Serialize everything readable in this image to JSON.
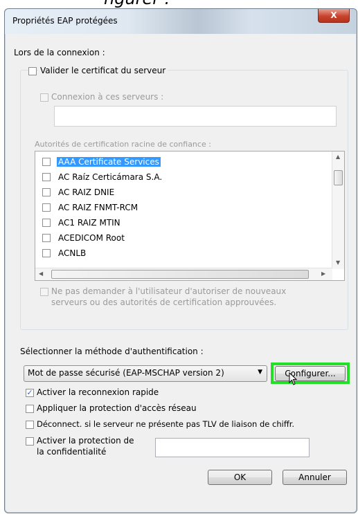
{
  "top_fragment": "ngurer :",
  "window": {
    "title": "Propriétés EAP protégées",
    "close_label": "X"
  },
  "section_connect": "Lors de la connexion :",
  "validate_cert": {
    "label": "Valider le certificat du serveur",
    "checked": false
  },
  "connect_servers": {
    "label": "Connexion à ces serveurs :",
    "checked": false,
    "value": ""
  },
  "trusted_roots_label": "Autorités de certification racine de confiance :",
  "cert_list": [
    {
      "label": "AAA Certificate Services",
      "checked": false,
      "selected": true
    },
    {
      "label": "AC Raíz Certicámara S.A.",
      "checked": false,
      "selected": false
    },
    {
      "label": "AC RAIZ DNIE",
      "checked": false,
      "selected": false
    },
    {
      "label": "AC RAIZ FNMT-RCM",
      "checked": false,
      "selected": false
    },
    {
      "label": "AC1 RAIZ MTIN",
      "checked": false,
      "selected": false
    },
    {
      "label": "ACEDICOM Root",
      "checked": false,
      "selected": false
    },
    {
      "label": "ACNLB",
      "checked": false,
      "selected": false
    }
  ],
  "no_prompt": {
    "label_line1": "Ne pas demander à l'utilisateur d'autoriser de nouveaux",
    "label_line2": "serveurs ou des autorités de certification approuvées.",
    "checked": false
  },
  "auth_method_label": "Sélectionner la méthode d'authentification :",
  "auth_method_value": "Mot de passe sécurisé (EAP-MSCHAP version 2)",
  "configure_button": "Configurer...",
  "options": {
    "fast_reconnect": {
      "label": "Activer la reconnexion rapide",
      "checked": true
    },
    "nap": {
      "label": "Appliquer la protection d'accès réseau",
      "checked": false
    },
    "disconnect_tlv": {
      "label": "Déconnect. si le serveur ne présente pas TLV de liaison de chiffr.",
      "checked": false
    },
    "identity_privacy": {
      "label_line1": "Activer la protection de",
      "label_line2": "la confidentialité",
      "checked": false,
      "value": ""
    }
  },
  "ok_button": "OK",
  "cancel_button": "Annuler",
  "colors": {
    "highlight": "#22e028",
    "selection": "#3399ff"
  }
}
